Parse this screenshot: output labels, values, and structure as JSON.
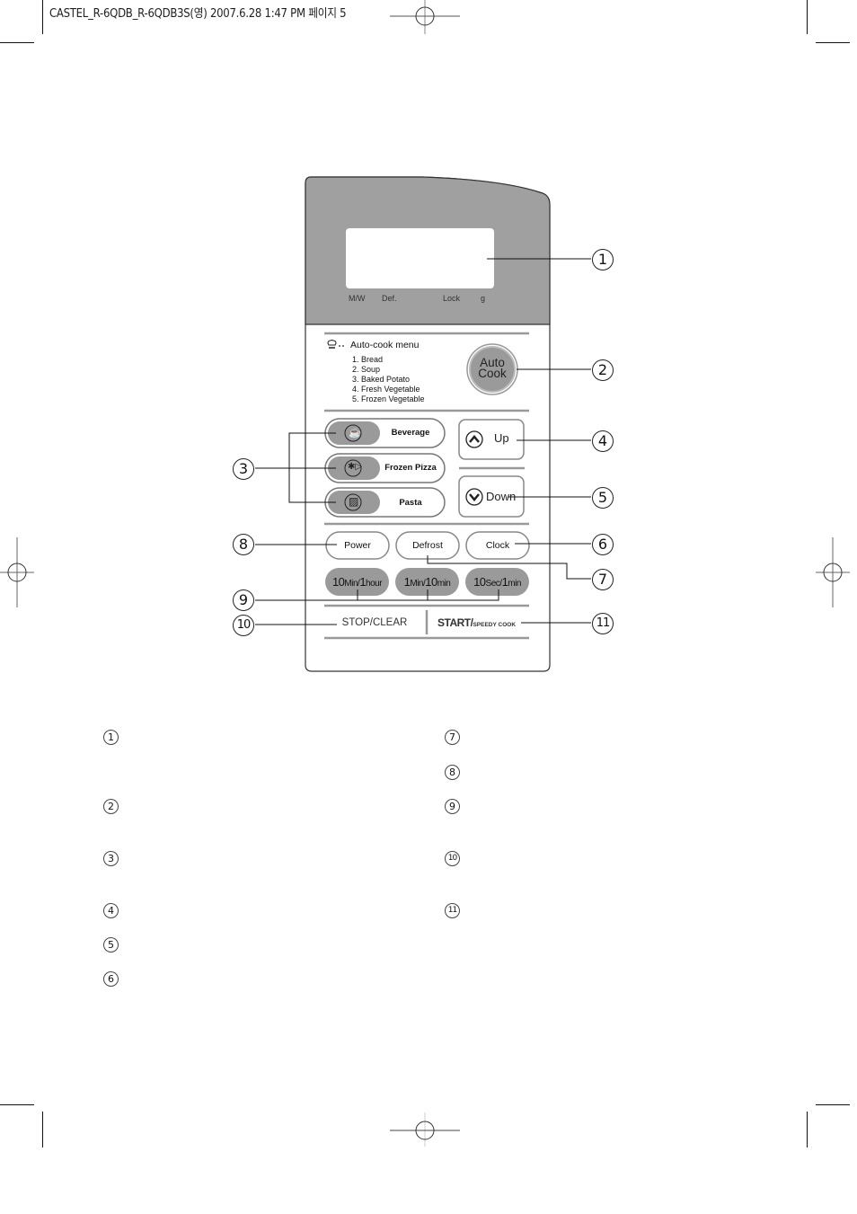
{
  "page_header": {
    "text": "CASTEL_R-6QDB_R-6QDB3S(영) 2007.6.28 1:47 PM 페이지 5"
  },
  "control_panel": {
    "display": {
      "indicators": [
        "M/W",
        "Def.",
        "Lock",
        "g"
      ]
    },
    "auto_cook_menu": {
      "icon": "chef-hat-icon",
      "title": "Auto-cook menu",
      "items": [
        "1. Bread",
        "2. Soup",
        "3. Baked Potato",
        "4. Fresh Vegetable",
        "5. Frozen Vegetable"
      ]
    },
    "auto_cook_button": {
      "line1": "Auto",
      "line2": "Cook"
    },
    "quick_buttons": [
      {
        "label": "Beverage",
        "icon": "cup-icon"
      },
      {
        "label": "Frozen Pizza",
        "icon": "pizza-icon"
      },
      {
        "label": "Pasta",
        "icon": "pasta-icon"
      }
    ],
    "up_button": {
      "label": "Up",
      "icon": "chevron-up-icon"
    },
    "down_button": {
      "label": "Down",
      "icon": "chevron-down-icon"
    },
    "mode_buttons": [
      {
        "label": "Power"
      },
      {
        "label": "Defrost"
      },
      {
        "label": "Clock"
      }
    ],
    "time_buttons": [
      {
        "big1": "10",
        "small1": "Min/",
        "big2": "1",
        "small2": "hour"
      },
      {
        "big1": "1",
        "small1": "Min/",
        "big2": "10",
        "small2": "min"
      },
      {
        "big1": "10",
        "small1": "Sec/",
        "big2": "1",
        "small2": "min"
      }
    ],
    "stop_clear": {
      "label": "STOP/CLEAR"
    },
    "start": {
      "label": "START/",
      "sub": "SPEEDY COOK"
    }
  },
  "callouts": {
    "right": [
      "1",
      "2",
      "4",
      "5",
      "6",
      "7",
      "11"
    ],
    "left": [
      "3",
      "8",
      "9",
      "10"
    ]
  },
  "legend": {
    "left": [
      "1",
      "2",
      "3",
      "4",
      "5",
      "6"
    ],
    "right": [
      "7",
      "8",
      "9",
      "10",
      "11"
    ]
  }
}
